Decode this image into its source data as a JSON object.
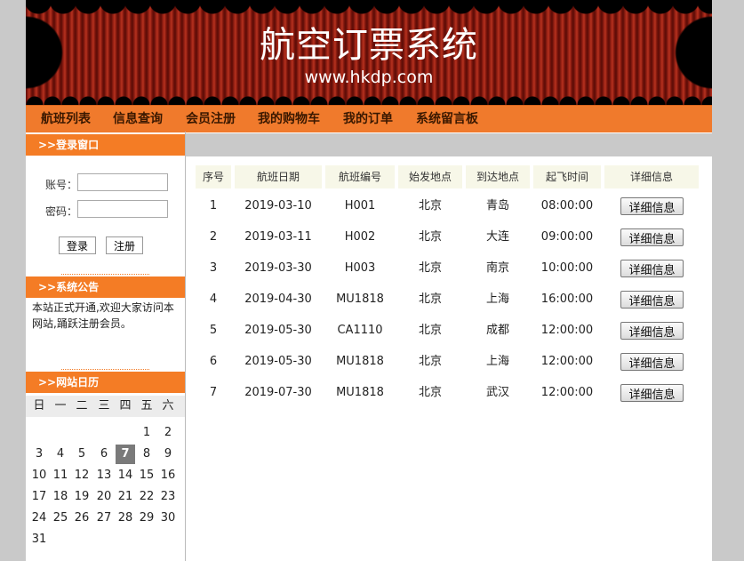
{
  "banner": {
    "title": "航空订票系统",
    "subtitle": "www.hkdp.com"
  },
  "nav": [
    "航班列表",
    "信息查询",
    "会员注册",
    "我的购物车",
    "我的订单",
    "系统留言板"
  ],
  "login": {
    "heading": ">>登录窗口",
    "account_label": "账号：",
    "password_label": "密码：",
    "account_value": "",
    "password_value": "",
    "login_button": "登录",
    "register_button": "注册"
  },
  "notice": {
    "heading": ">>系统公告",
    "text": "本站正式开通,欢迎大家访问本网站,踊跃注册会员。"
  },
  "calendar": {
    "heading": ">>网站日历",
    "weekdays": [
      "日",
      "一",
      "二",
      "三",
      "四",
      "五",
      "六"
    ],
    "first_weekday": 5,
    "days_in_month": 31,
    "today": 7
  },
  "flights": {
    "columns": [
      "序号",
      "航班日期",
      "航班编号",
      "始发地点",
      "到达地点",
      "起飞时间",
      "详细信息"
    ],
    "detail_label": "详细信息",
    "rows": [
      [
        "1",
        "2019-03-10",
        "H001",
        "北京",
        "青岛",
        "08:00:00"
      ],
      [
        "2",
        "2019-03-11",
        "H002",
        "北京",
        "大连",
        "09:00:00"
      ],
      [
        "3",
        "2019-03-30",
        "H003",
        "北京",
        "南京",
        "10:00:00"
      ],
      [
        "4",
        "2019-04-30",
        "MU1818",
        "北京",
        "上海",
        "16:00:00"
      ],
      [
        "5",
        "2019-05-30",
        "CA1110",
        "北京",
        "成都",
        "12:00:00"
      ],
      [
        "6",
        "2019-05-30",
        "MU1818",
        "北京",
        "上海",
        "12:00:00"
      ],
      [
        "7",
        "2019-07-30",
        "MU1818",
        "北京",
        "武汉",
        "12:00:00"
      ]
    ]
  }
}
